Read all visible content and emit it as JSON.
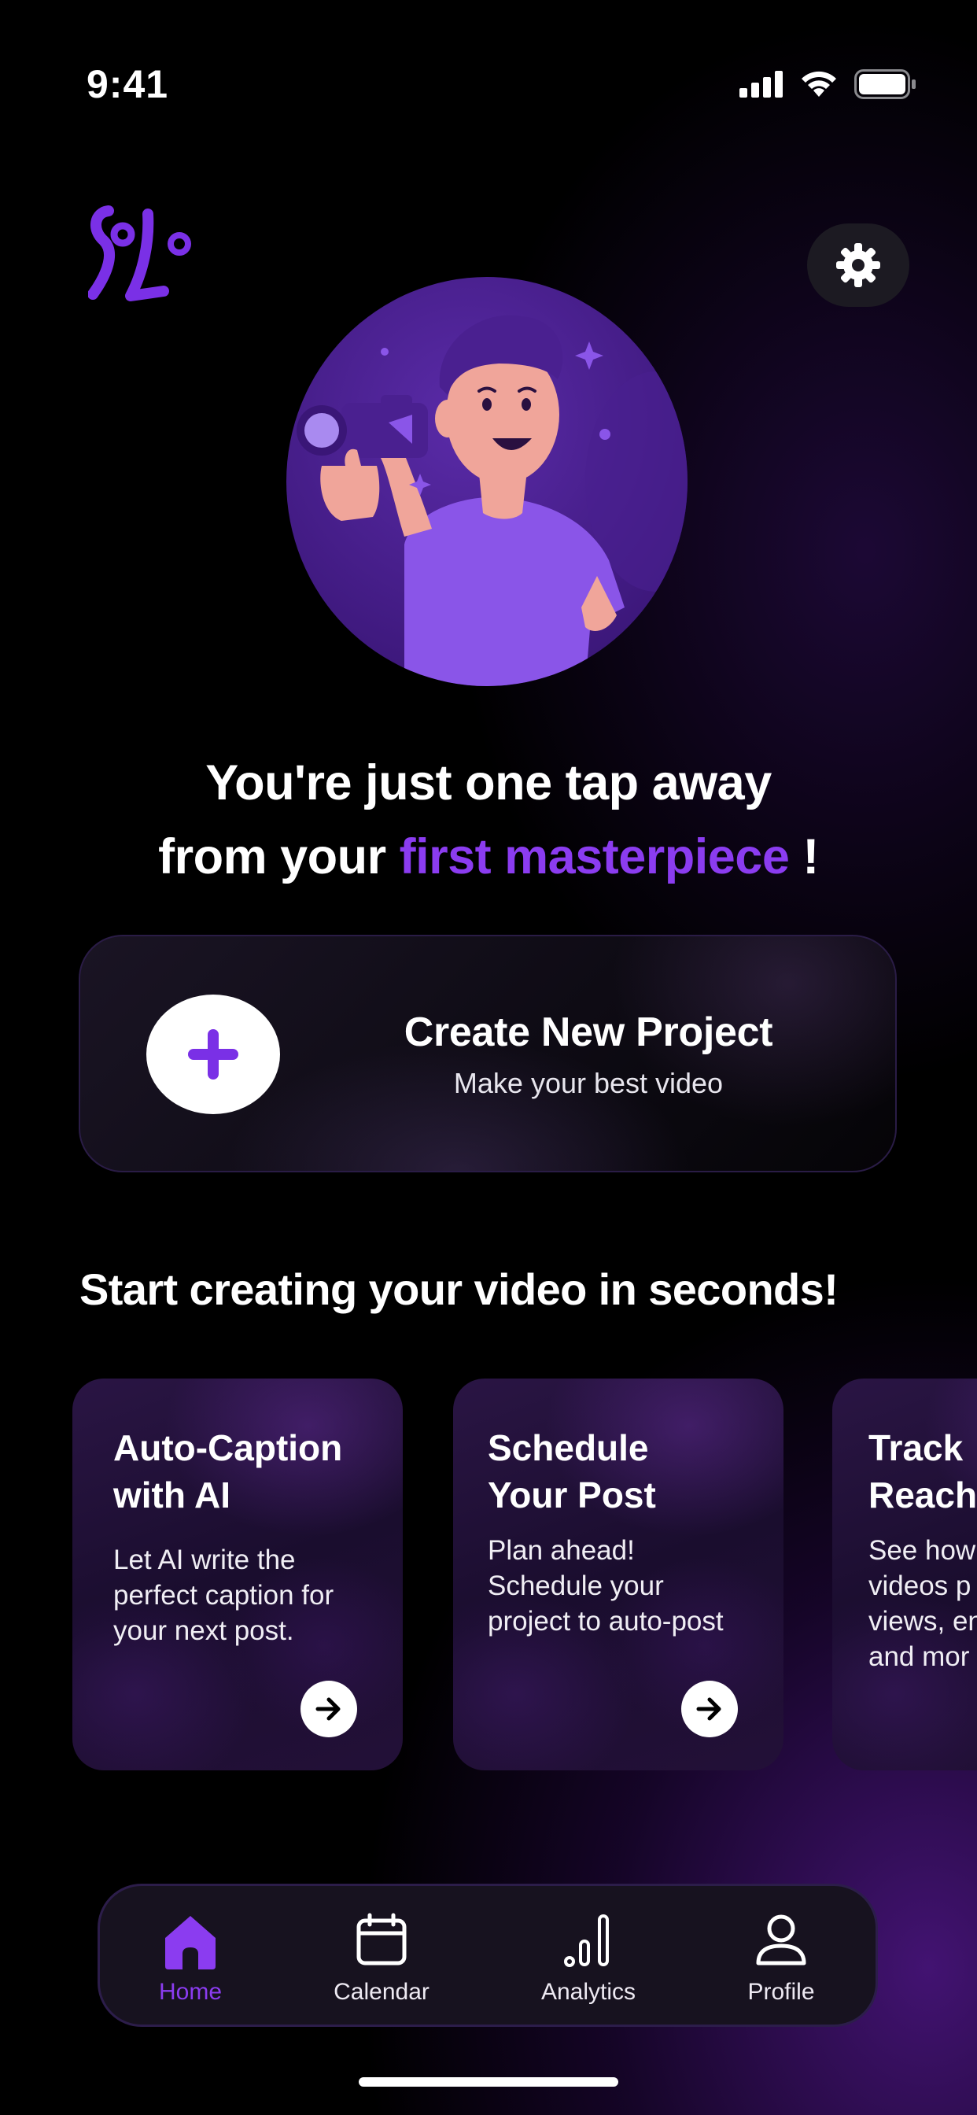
{
  "status_bar": {
    "time": "9:41"
  },
  "header": {
    "logo_alt": "Solo"
  },
  "hero": {
    "headline_line1": "You're just one tap away",
    "headline_prefix": "from your ",
    "headline_accent": "first masterpiece",
    "headline_suffix": " !"
  },
  "create_card": {
    "title": "Create New Project",
    "subtitle": "Make your best video"
  },
  "section": {
    "title": "Start creating your video  in seconds!"
  },
  "features": [
    {
      "title_line1": "Auto-Caption",
      "title_line2": "with AI",
      "desc_line1": "Let AI write the",
      "desc_line2": "perfect caption for",
      "desc_line3": "your next post.",
      "desc_line4": ""
    },
    {
      "title_line1": "Schedule",
      "title_line2": "Your Post",
      "desc_line1": "Plan ahead!",
      "desc_line2": "Schedule your",
      "desc_line3": "project to auto-post",
      "desc_line4": ""
    },
    {
      "title_line1": "Track",
      "title_line2": "Reach",
      "desc_line1": "See how",
      "desc_line2": "videos p",
      "desc_line3": "views, en",
      "desc_line4": "and mor"
    }
  ],
  "nav": {
    "items": [
      {
        "label": "Home",
        "icon": "home-icon",
        "active": true
      },
      {
        "label": "Calendar",
        "icon": "calendar-icon",
        "active": false
      },
      {
        "label": "Analytics",
        "icon": "analytics-icon",
        "active": false
      },
      {
        "label": "Profile",
        "icon": "profile-icon",
        "active": false
      }
    ]
  },
  "colors": {
    "accent": "#8b3cf0",
    "background": "#000000",
    "card": "#17121f"
  }
}
